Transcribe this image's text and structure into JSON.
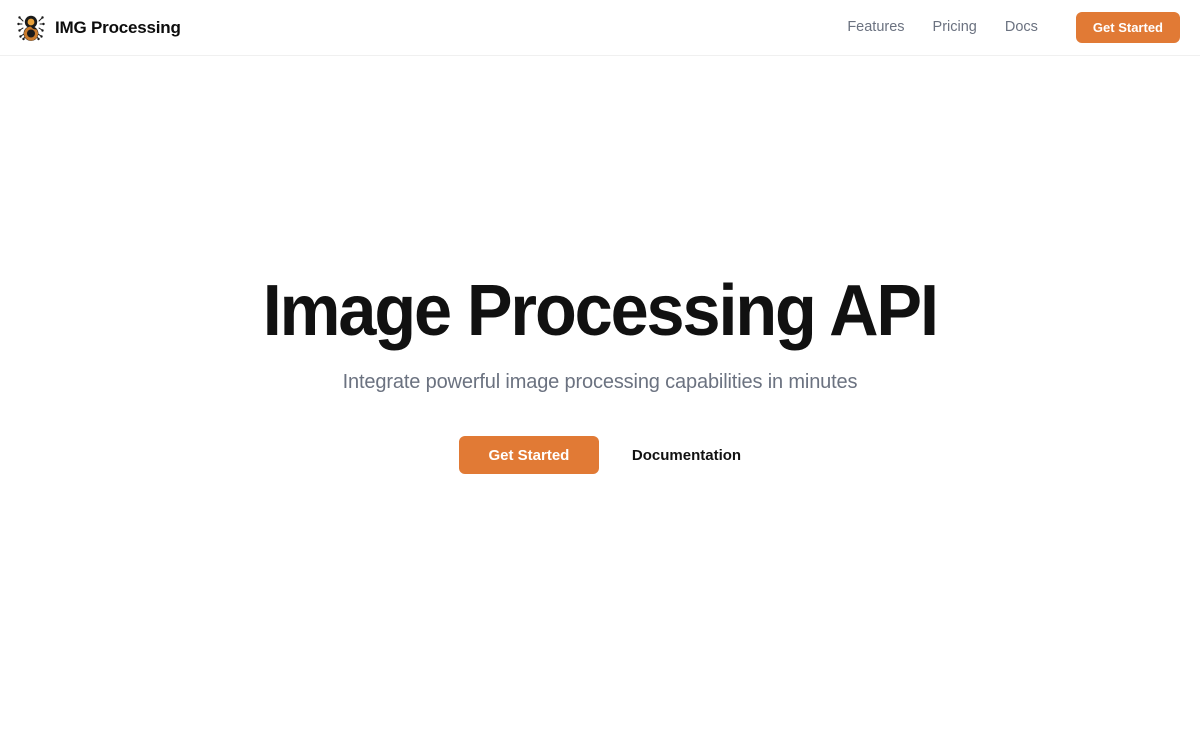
{
  "brand": {
    "name": "IMG Processing",
    "logo_icon": "figure-eight-circuit-logo",
    "logo_colors": {
      "accent": "#e8a13a",
      "dark": "#1a1a1a",
      "mid": "#c97a2c"
    }
  },
  "nav": {
    "links": [
      {
        "label": "Features"
      },
      {
        "label": "Pricing"
      },
      {
        "label": "Docs"
      }
    ],
    "cta_label": "Get Started"
  },
  "hero": {
    "title": "Image Processing API",
    "subtitle": "Integrate powerful image processing capabilities in minutes",
    "primary_label": "Get Started",
    "secondary_label": "Documentation"
  },
  "colors": {
    "accent": "#e17a35",
    "text_primary": "#111111",
    "text_muted": "#6b7280",
    "background": "#ffffff",
    "border": "#f0f0f0"
  }
}
